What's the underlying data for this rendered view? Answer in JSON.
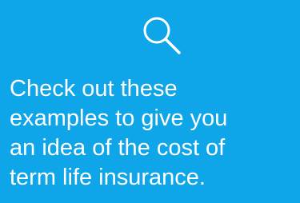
{
  "hero": {
    "icon": "search-icon",
    "message": "Check out these\nexamples to give you\nan idea of the cost of\nterm life insurance."
  },
  "colors": {
    "background": "#0ea5e9",
    "text": "#ffffff"
  }
}
